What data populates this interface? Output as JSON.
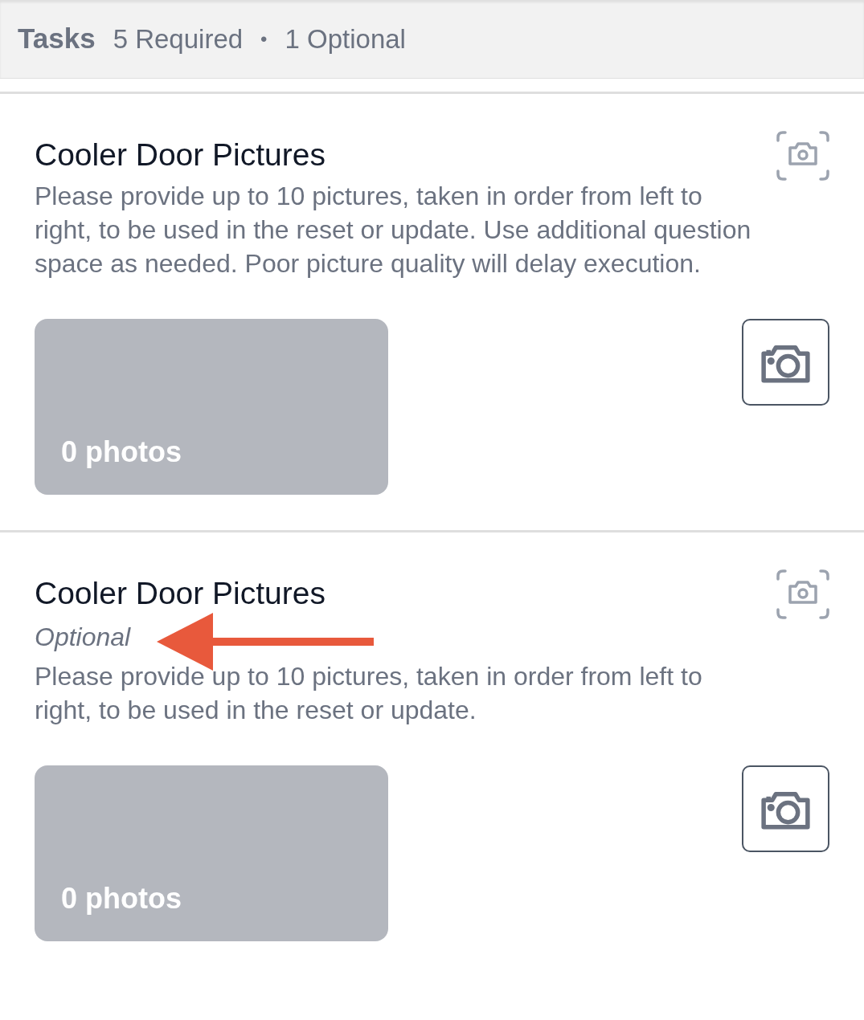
{
  "header": {
    "title": "Tasks",
    "required": "5 Required",
    "separator": "•",
    "optional": "1 Optional"
  },
  "tasks": [
    {
      "title": "Cooler Door Pictures",
      "description": "Please provide up to 10 pictures, taken in order from left to right, to be used in the reset or update. Use additional question space as needed. Poor picture quality will delay execution.",
      "photos": "0 photos",
      "annotated": false
    },
    {
      "title": "Cooler Door Pictures",
      "tag": "Optional",
      "description": "Please provide up to 10 pictures, taken in order from left to right, to be used in the reset or update.",
      "photos": "0 photos",
      "annotated": true
    }
  ]
}
